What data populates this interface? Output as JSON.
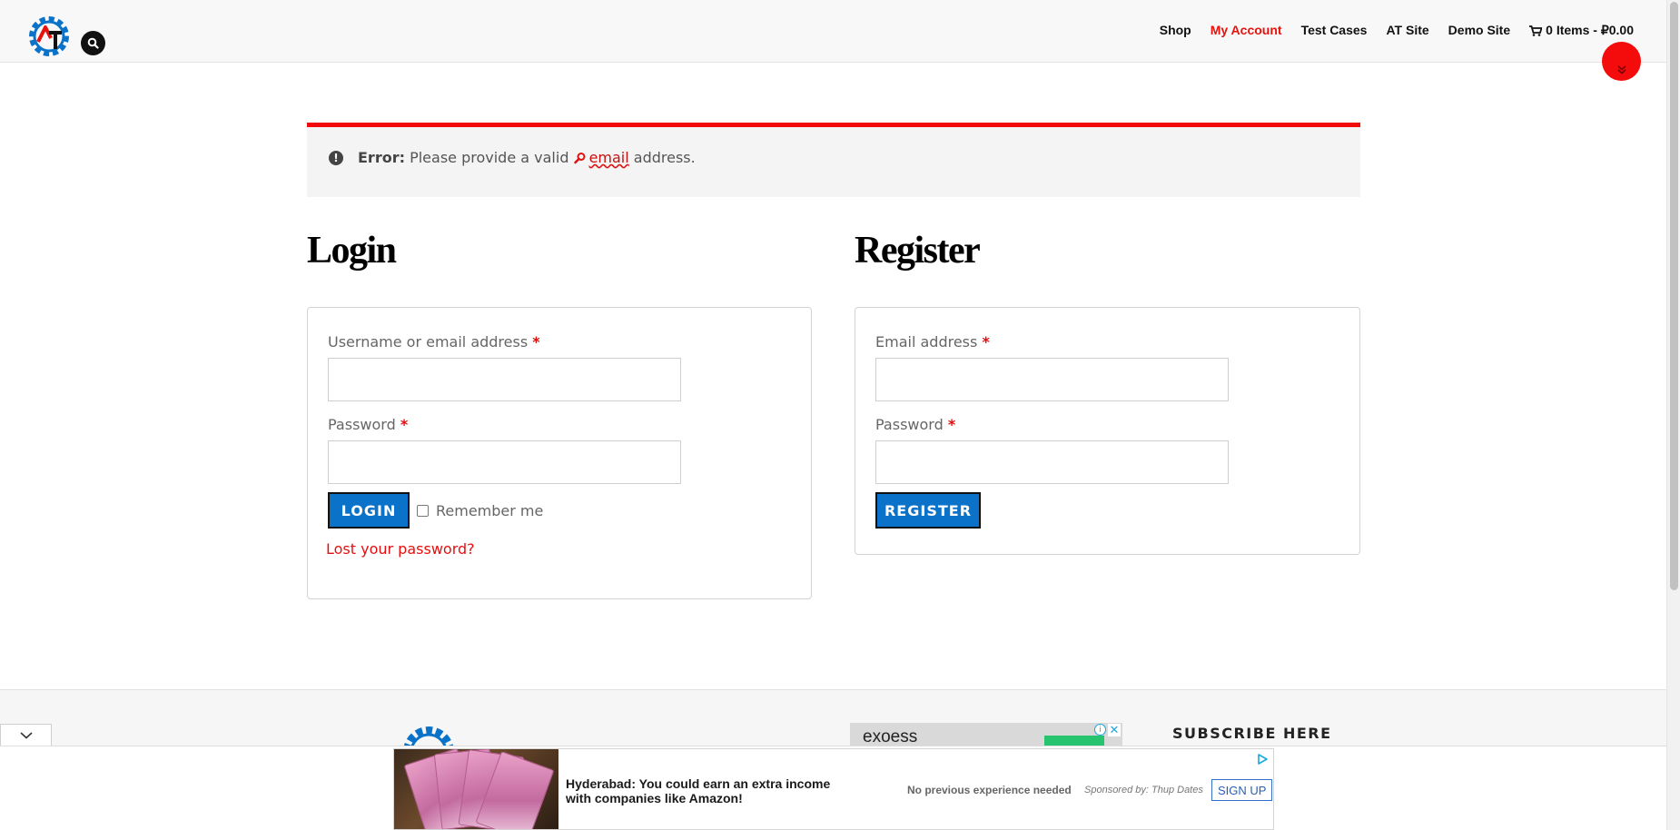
{
  "header": {
    "nav": [
      "Shop",
      "My Account",
      "Test Cases",
      "AT Site",
      "Demo Site"
    ],
    "active_nav": "My Account",
    "cart_label": "0 Items - ₽0.00"
  },
  "notice": {
    "prefix": "Error:",
    "text_before": " Please provide a valid ",
    "link_text": "email",
    "text_after": " address."
  },
  "login": {
    "heading": "Login",
    "username_label": "Username or email address",
    "password_label": "Password",
    "required_mark": "*",
    "button": "LOGIN",
    "remember_label": "Remember me",
    "lost_password": "Lost your password?"
  },
  "register": {
    "heading": "Register",
    "email_label": "Email address",
    "password_label": "Password",
    "required_mark": "*",
    "button": "REGISTER"
  },
  "footer": {
    "subscribe_heading": "SUBSCRIBE HERE",
    "ad_thumb_text": "exoess"
  },
  "ad": {
    "headline": "Hyderabad: You could earn an extra income with companies like Amazon!",
    "subtext": "No previous experience needed",
    "sponsor": "Sponsored by: Thup Dates",
    "cta": "SIGN UP"
  },
  "colors": {
    "accent_red": "#f10b0b",
    "button_blue": "#0a72c9",
    "link_red": "#e50f0f"
  },
  "icons": [
    "site-logo",
    "search-icon",
    "cart-icon",
    "chevron-double-down-icon",
    "exclamation-icon",
    "magnifier-icon",
    "chevron-down-icon",
    "adchoices-icon"
  ]
}
